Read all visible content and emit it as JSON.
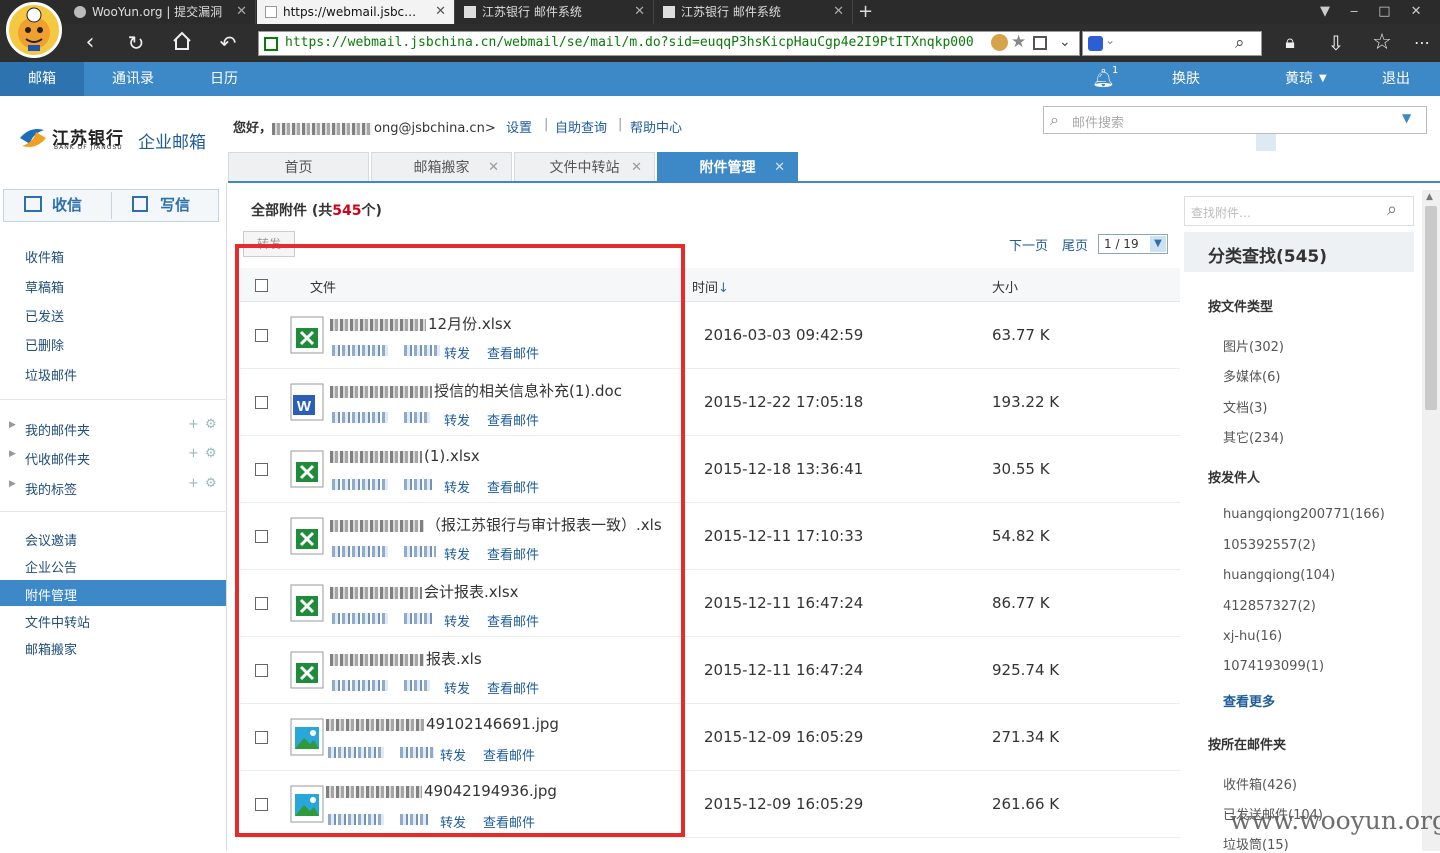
{
  "browser": {
    "tabs": [
      {
        "label": "WooYun.org | 提交漏洞",
        "active": false
      },
      {
        "label": "https://webmail.jsbc…",
        "active": true
      },
      {
        "label": "江苏银行 邮件系统",
        "active": false
      },
      {
        "label": "江苏银行 邮件系统",
        "active": false
      }
    ],
    "url": "https://webmail.jsbchina.cn/webmail/se/mail/m.do?sid=euqqP3hsKicpHauCgp4e2I9PtITXnqkp000"
  },
  "appnav": {
    "items": [
      "邮箱",
      "通讯录",
      "日历"
    ],
    "notif_count": "1",
    "skin": "换肤",
    "user": "黄琼",
    "logout": "退出"
  },
  "header": {
    "logo_cn": "江苏银行",
    "logo_en": "BANK OF JIANGSU",
    "logo_suffix": "企业邮箱",
    "greeting_prefix": "您好，",
    "greeting_email": "ong@jsbchina.cn>",
    "links": [
      "设置",
      "自助查询",
      "帮助中心"
    ],
    "search_placeholder": "邮件搜索"
  },
  "app_tabs": [
    {
      "label": "首页",
      "active": false,
      "closable": false
    },
    {
      "label": "邮箱搬家",
      "active": false,
      "closable": true
    },
    {
      "label": "文件中转站",
      "active": false,
      "closable": true
    },
    {
      "label": "附件管理",
      "active": true,
      "closable": true
    }
  ],
  "sidebar": {
    "receive": "收信",
    "compose": "写信",
    "folders": [
      "收件箱",
      "草稿箱",
      "已发送",
      "已删除",
      "垃圾邮件"
    ],
    "custom": [
      "我的邮件夹",
      "代收邮件夹",
      "我的标签"
    ],
    "apps": [
      "会议邀请",
      "企业公告",
      "附件管理",
      "文件中转站",
      "邮箱搬家"
    ],
    "active_app": "附件管理"
  },
  "main": {
    "title_prefix": "全部附件 (共",
    "total": "545",
    "title_suffix": "个)",
    "forward_btn": "转发",
    "pager_next": "下一页",
    "pager_last": "尾页",
    "pager_value": "1 / 19",
    "col_name": "文件",
    "col_time": "时间",
    "col_size": "大小",
    "forward": "转发",
    "view_mail": "查看邮件",
    "rows": [
      {
        "type": "excel",
        "name": "12月份.xlsx",
        "time": "2016-03-03 09:42:59",
        "size": "63.77 K"
      },
      {
        "type": "word",
        "name": "授信的相关信息补充(1).doc",
        "time": "2015-12-22 17:05:18",
        "size": "193.22 K"
      },
      {
        "type": "excel",
        "name": "(1).xlsx",
        "time": "2015-12-18 13:36:41",
        "size": "30.55 K"
      },
      {
        "type": "excel",
        "name": "（报江苏银行与审计报表一致）.xls",
        "time": "2015-12-11 17:10:33",
        "size": "54.82 K"
      },
      {
        "type": "excel",
        "name": "会计报表.xlsx",
        "time": "2015-12-11 16:47:24",
        "size": "86.77 K"
      },
      {
        "type": "excel",
        "name": "报表.xls",
        "time": "2015-12-11 16:47:24",
        "size": "925.74 K"
      },
      {
        "type": "image",
        "name": "49102146691.jpg",
        "time": "2015-12-09 16:05:29",
        "size": "271.34 K"
      },
      {
        "type": "image",
        "name": "49042194936.jpg",
        "time": "2015-12-09 16:05:29",
        "size": "261.66 K"
      }
    ]
  },
  "right_panel": {
    "search_placeholder": "查找附件…",
    "title": "分类查找(545)",
    "by_type_title": "按文件类型",
    "by_type": [
      "图片(302)",
      "多媒体(6)",
      "文档(3)",
      "其它(234)"
    ],
    "by_sender_title": "按发件人",
    "by_sender": [
      "huangqiong200771(166)",
      "105392557(2)",
      "huangqiong(104)",
      "412857327(2)",
      "xj-hu(16)",
      "1074193099(1)"
    ],
    "more": "查看更多",
    "by_folder_title": "按所在邮件夹",
    "by_folder": [
      "收件箱(426)",
      "已发送邮件(104)",
      "垃圾筒(15)"
    ]
  },
  "watermark": "www.wooyun.org",
  "colors": {
    "brand_blue": "#3d88c6",
    "highlight_red": "#e52b2b",
    "count_red": "#d0021b",
    "excel_green": "#1e8c3a",
    "word_blue": "#2b5eb8"
  }
}
